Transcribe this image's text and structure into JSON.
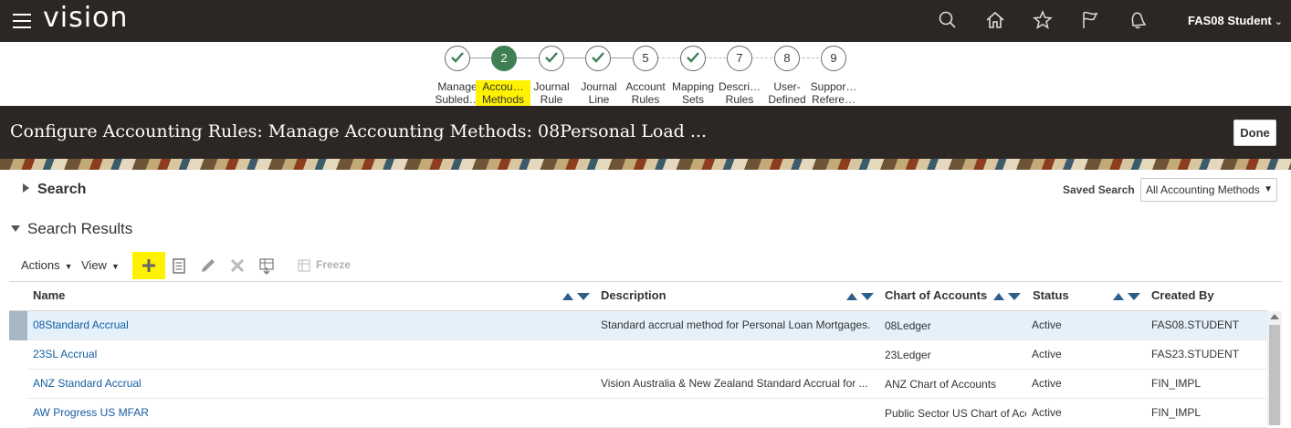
{
  "topbar": {
    "brand": "vision",
    "user_name": "FAS08 Student",
    "icons": [
      "search-icon",
      "home-icon",
      "favorites-star-icon",
      "watchlist-flag-icon",
      "notifications-bell-icon"
    ]
  },
  "train": {
    "stops": [
      {
        "marker": "",
        "state": "done",
        "label_line1": "Manage",
        "label_line2": "Subled…"
      },
      {
        "marker": "2",
        "state": "current",
        "label_line1": "Accou…",
        "label_line2": "Methods"
      },
      {
        "marker": "",
        "state": "done",
        "label_line1": "Journal",
        "label_line2": "Rule"
      },
      {
        "marker": "",
        "state": "done",
        "label_line1": "Journal",
        "label_line2": "Line"
      },
      {
        "marker": "5",
        "state": "todo",
        "label_line1": "Account",
        "label_line2": "Rules"
      },
      {
        "marker": "",
        "state": "done",
        "label_line1": "Mapping",
        "label_line2": "Sets"
      },
      {
        "marker": "7",
        "state": "todo",
        "label_line1": "Descri…",
        "label_line2": "Rules"
      },
      {
        "marker": "8",
        "state": "todo",
        "label_line1": "User-",
        "label_line2": "Defined"
      },
      {
        "marker": "9",
        "state": "todo",
        "label_line1": "Suppor…",
        "label_line2": "Refere…"
      }
    ]
  },
  "header": {
    "title": "Configure Accounting Rules: Manage Accounting Methods: 08Personal Load ...",
    "done_label": "Done"
  },
  "search": {
    "label": "Search",
    "saved_search_label": "Saved Search",
    "saved_search_value": "All Accounting Methods"
  },
  "results": {
    "title": "Search Results",
    "actions_label": "Actions",
    "view_label": "View",
    "freeze_label": "Freeze",
    "toolbar_icons": [
      "add-icon",
      "view-details-icon",
      "edit-pencil-icon",
      "delete-x-icon",
      "export-icon"
    ],
    "columns": [
      "Name",
      "Description",
      "Chart of Accounts",
      "Status",
      "Created By"
    ],
    "rows": [
      {
        "name": "08Standard Accrual",
        "description": "Standard accrual method for Personal Loan Mortgages.",
        "chart": "08Ledger",
        "status": "Active",
        "created_by": "FAS08.STUDENT"
      },
      {
        "name": "23SL Accrual",
        "description": "",
        "chart": "23Ledger",
        "status": "Active",
        "created_by": "FAS23.STUDENT"
      },
      {
        "name": "ANZ Standard Accrual",
        "description": "Vision Australia & New Zealand Standard Accrual for ...",
        "chart": "ANZ Chart of Accounts",
        "status": "Active",
        "created_by": "FIN_IMPL"
      },
      {
        "name": "AW Progress US MFAR",
        "description": "",
        "chart": "Public Sector US Chart of Acc",
        "status": "Active",
        "created_by": "FIN_IMPL"
      }
    ]
  },
  "colors": {
    "topbar_bg": "#2c2724",
    "current_step": "#3e7f54",
    "highlight": "#fff200",
    "link": "#145c9e",
    "selected_row": "#e4f1fb"
  }
}
